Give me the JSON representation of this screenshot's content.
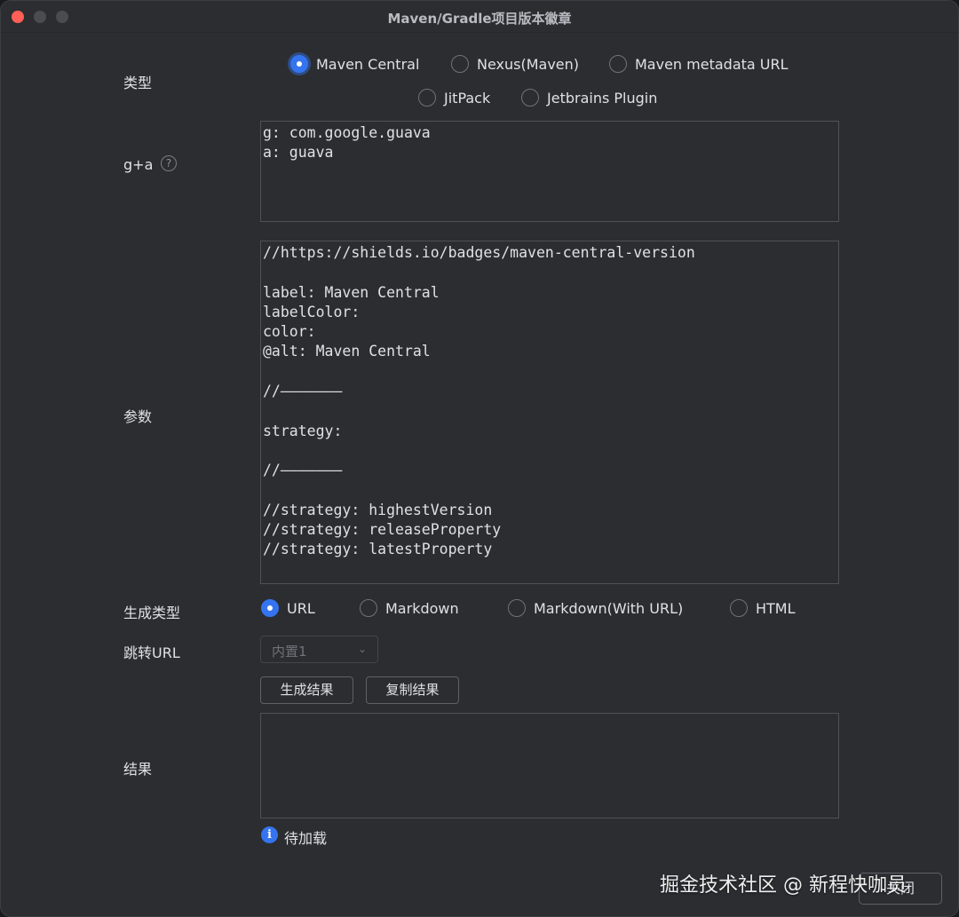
{
  "window": {
    "title": "Maven/Gradle项目版本徽章"
  },
  "labels": {
    "type": "类型",
    "ga": "g+a",
    "params": "参数",
    "gen_type": "生成类型",
    "redirect_url": "跳转URL",
    "result": "结果"
  },
  "type_options": [
    {
      "label": "Maven Central",
      "checked": true
    },
    {
      "label": "Nexus(Maven)",
      "checked": false
    },
    {
      "label": "Maven metadata URL",
      "checked": false
    },
    {
      "label": "JitPack",
      "checked": false
    },
    {
      "label": "Jetbrains Plugin",
      "checked": false
    }
  ],
  "ga_value": "g: com.google.guava\na: guava",
  "params_value": "//https://shields.io/badges/maven-central-version\n\nlabel: Maven Central\nlabelColor:\ncolor:\n@alt: Maven Central\n\n//———————\n\nstrategy:\n\n//———————\n\n//strategy: highestVersion\n//strategy: releaseProperty\n//strategy: latestProperty",
  "gen_options": [
    {
      "label": "URL",
      "checked": true
    },
    {
      "label": "Markdown",
      "checked": false
    },
    {
      "label": "Markdown(With URL)",
      "checked": false
    },
    {
      "label": "HTML",
      "checked": false
    }
  ],
  "redirect_select": {
    "value": "内置1"
  },
  "buttons": {
    "generate": "生成结果",
    "copy": "复制结果",
    "close": "关闭"
  },
  "result_value": "",
  "status": {
    "text": "待加载",
    "icon": "info-icon"
  },
  "watermark": "掘金技术社区 @ 新程快咖员",
  "colors": {
    "accent": "#3574f0",
    "background": "#2b2d30",
    "close": "#ff5f57"
  }
}
